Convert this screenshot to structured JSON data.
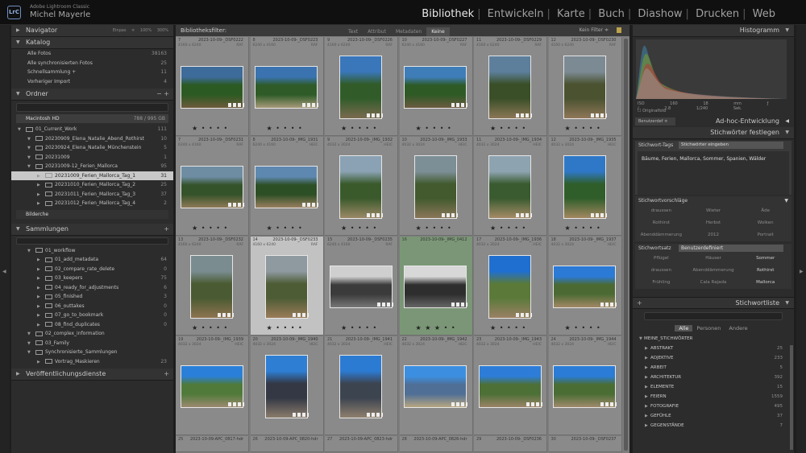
{
  "app": {
    "logo": "LrC",
    "subtitle": "Adobe Lightroom Classic",
    "user": "Michel Mayerle"
  },
  "modules": [
    "Bibliothek",
    "Entwickeln",
    "Karte",
    "Buch",
    "Diashow",
    "Drucken",
    "Web"
  ],
  "active_module": "Bibliothek",
  "left": {
    "navigator": {
      "title": "Navigator",
      "zoom_options": [
        "Einpas ≑",
        "100%",
        "300%"
      ]
    },
    "catalog": {
      "title": "Katalog",
      "items": [
        {
          "label": "Alle Fotos",
          "count": "38163"
        },
        {
          "label": "Alle synchronisierten Fotos",
          "count": "25"
        },
        {
          "label": "Schnellsammlung +",
          "count": "11"
        },
        {
          "label": "Vorheriger Import",
          "count": "4"
        }
      ]
    },
    "folders": {
      "title": "Ordner",
      "volume": "Macintosh HD",
      "volume_info": "788 / 995 GB",
      "items": [
        {
          "label": "01_Current_Work",
          "count": "111",
          "indent": 0
        },
        {
          "label": "20230909_Elena_Natalie_Abend_Rothirst",
          "count": "10",
          "indent": 1
        },
        {
          "label": "20230924_Elena_Natalie_Münchenstein",
          "count": "5",
          "indent": 1
        },
        {
          "label": "20231009",
          "count": "1",
          "indent": 1
        },
        {
          "label": "20231009-12_Ferien_Mallorca",
          "count": "95",
          "indent": 1
        },
        {
          "label": "20231009_Ferien_Mallorca_Tag_1",
          "count": "31",
          "indent": 2,
          "selected": true
        },
        {
          "label": "20231010_Ferien_Mallorca_Tag_2",
          "count": "25",
          "indent": 2
        },
        {
          "label": "20231011_Ferien_Mallorca_Tag_3",
          "count": "37",
          "indent": 2
        },
        {
          "label": "20231012_Ferien_Mallorca_Tag_4",
          "count": "2",
          "indent": 2
        }
      ],
      "footer": "Bilderche"
    },
    "collections": {
      "title": "Sammlungen",
      "items": [
        {
          "label": "01_workflow",
          "count": "",
          "indent": 1
        },
        {
          "label": "01_add_metadata",
          "count": "64",
          "indent": 2
        },
        {
          "label": "02_compare_rate_delete",
          "count": "0",
          "indent": 2
        },
        {
          "label": "03_keepers",
          "count": "75",
          "indent": 2
        },
        {
          "label": "04_ready_for_adjustments",
          "count": "6",
          "indent": 2
        },
        {
          "label": "05_finished",
          "count": "3",
          "indent": 2
        },
        {
          "label": "06_outtakes",
          "count": "0",
          "indent": 2
        },
        {
          "label": "07_go_to_bookmark",
          "count": "0",
          "indent": 2
        },
        {
          "label": "08_find_duplicates",
          "count": "0",
          "indent": 2
        },
        {
          "label": "02_complex_information",
          "count": "",
          "indent": 1
        },
        {
          "label": "03_Family",
          "count": "",
          "indent": 1
        },
        {
          "label": "Synchronisierte_Sammlungen",
          "count": "",
          "indent": 1
        },
        {
          "label": "Vortrag_Maskieren",
          "count": "23",
          "indent": 2
        }
      ]
    },
    "publish": {
      "title": "Veröffentlichungsdienste"
    }
  },
  "filterbar": {
    "label": "Bibliotheksfilter:",
    "tabs": [
      "Text",
      "Attribut",
      "Metadaten",
      "Keine"
    ],
    "active": "Keine",
    "preset": "Kein Filter ≑"
  },
  "grid": {
    "cells": [
      {
        "num": "7",
        "name": "2023-10-09-_DSF0222",
        "dim": "4160 x 6240",
        "ext": "RAF",
        "orient": "land",
        "c": [
          "#3d6b9a",
          "#2b5a22",
          "#6d5a3b"
        ],
        "stars": "★ • • • •"
      },
      {
        "num": "8",
        "name": "2023-10-09-_DSF0223",
        "dim": "6240 x 4160",
        "ext": "RAF",
        "orient": "land",
        "c": [
          "#3a73b0",
          "#2e5b27",
          "#a89a7a"
        ],
        "stars": "★ • • • •"
      },
      {
        "num": "9",
        "name": "2023-10-09-_DSF0226",
        "dim": "4160 x 6240",
        "ext": "RAF",
        "orient": "port",
        "c": [
          "#3a77ba",
          "#315c2a",
          "#7a6a4f"
        ],
        "stars": "★ • • • •"
      },
      {
        "num": "10",
        "name": "2023-10-09-_DSF0227",
        "dim": "6240 x 4160",
        "ext": "RAF",
        "orient": "land",
        "c": [
          "#3f7db9",
          "#2e5a26",
          "#6b5a40"
        ],
        "stars": "★ • • • •"
      },
      {
        "num": "11",
        "name": "2023-10-09-_DSF0229",
        "dim": "4160 x 6240",
        "ext": "RAF",
        "orient": "port",
        "c": [
          "#5d7f9c",
          "#3a4f28",
          "#8c7656"
        ],
        "stars": "★ • • • •"
      },
      {
        "num": "12",
        "name": "2023-10-09-_DSF0230",
        "dim": "4160 x 6240",
        "ext": "RAF",
        "orient": "port",
        "c": [
          "#7c8a94",
          "#4a5230",
          "#8f7758"
        ],
        "stars": "★ • • • •"
      },
      {
        "num": "7",
        "name": "2023-10-09-_DSF0231",
        "dim": "6240 x 4160",
        "ext": "RAF",
        "orient": "land",
        "c": [
          "#6e8da3",
          "#34532a",
          "#8f7a58"
        ],
        "stars": "★ • • • •"
      },
      {
        "num": "8",
        "name": "2023-10-09-_IMG_1931",
        "dim": "6240 x 4160",
        "ext": "HEIC",
        "orient": "land",
        "c": [
          "#5f88b0",
          "#2d4f25",
          "#9a7f60"
        ],
        "stars": "★ • • • •"
      },
      {
        "num": "9",
        "name": "2023-10-09-_IMG_1932",
        "dim": "4032 x 3024",
        "ext": "HEIC",
        "orient": "port",
        "c": [
          "#8aa2b3",
          "#3a5a2c",
          "#9b8866"
        ],
        "stars": "★ • • • •"
      },
      {
        "num": "10",
        "name": "2023-10-09-_IMG_1933",
        "dim": "4032 x 3024",
        "ext": "HEIC",
        "orient": "port",
        "c": [
          "#7c8f96",
          "#425a2e",
          "#8a7658"
        ],
        "stars": "★ • • • •"
      },
      {
        "num": "11",
        "name": "2023-10-09-_IMG_1934",
        "dim": "4032 x 3024",
        "ext": "HEIC",
        "orient": "port",
        "c": [
          "#8ea3b0",
          "#3a5b30",
          "#a48b66"
        ],
        "stars": "★ • • • •"
      },
      {
        "num": "12",
        "name": "2023-10-09-_IMG_1935",
        "dim": "4032 x 3024",
        "ext": "HEIC",
        "orient": "port",
        "c": [
          "#2f78c7",
          "#2f5e2a",
          "#a38760"
        ],
        "stars": "★ • • • •"
      },
      {
        "num": "13",
        "name": "2023-10-09-_DSF0232",
        "dim": "4160 x 6240",
        "ext": "RAF",
        "orient": "port",
        "c": [
          "#7a8c90",
          "#4a5b33",
          "#8e7350"
        ],
        "stars": "★ • • • •"
      },
      {
        "num": "14",
        "name": "2023-10-09-_DSF0233",
        "dim": "4160 x 6240",
        "ext": "RAF",
        "orient": "port",
        "c": [
          "#8f9aa0",
          "#4d5c35",
          "#9a7c58"
        ],
        "stars": "★ • • • •",
        "sel": true
      },
      {
        "num": "15",
        "name": "2023-10-09-_DSF0235",
        "dim": "6240 x 4160",
        "ext": "RAF",
        "orient": "land",
        "c": [
          "#cfcfcf",
          "#3b3b3b",
          "#777777"
        ],
        "stars": "★ • • • •"
      },
      {
        "num": "16",
        "name": "2023-10-09-_IMG_0412",
        "dim": "",
        "ext": "",
        "orient": "land",
        "c": [
          "#d8d8d8",
          "#2e2e2e",
          "#666666"
        ],
        "stars": "★ ★ ★ • •",
        "green": true
      },
      {
        "num": "17",
        "name": "2023-10-09-_IMG_1936",
        "dim": "4032 x 3024",
        "ext": "HEIC",
        "orient": "port",
        "c": [
          "#1f6fd0",
          "#5b7a3a",
          "#9a8064"
        ],
        "stars": "★ • • • •"
      },
      {
        "num": "18",
        "name": "2023-10-09-_IMG_1937",
        "dim": "4032 x 3024",
        "ext": "HEIC",
        "orient": "land",
        "c": [
          "#2b7ad6",
          "#4b6a33",
          "#a38866"
        ],
        "stars": "★ • • • •"
      },
      {
        "num": "19",
        "name": "2023-10-09-_IMG_1939",
        "dim": "4032 x 3024",
        "ext": "HEIC",
        "orient": "land",
        "c": [
          "#2a80d8",
          "#4f7a3a",
          "#9c8a70"
        ],
        "stars": ""
      },
      {
        "num": "20",
        "name": "2023-10-09-_IMG_1940",
        "dim": "4032 x 3024",
        "ext": "HEIC",
        "orient": "port",
        "c": [
          "#2e7fd4",
          "#333844",
          "#8a7c6c"
        ],
        "stars": ""
      },
      {
        "num": "21",
        "name": "2023-10-09-_IMG_1941",
        "dim": "4032 x 3024",
        "ext": "HEIC",
        "orient": "port",
        "c": [
          "#2c7bd3",
          "#3c4450",
          "#8e7f6e"
        ],
        "stars": ""
      },
      {
        "num": "22",
        "name": "2023-10-09-_IMG_1942",
        "dim": "4032 x 3024",
        "ext": "HEIC",
        "orient": "land",
        "c": [
          "#3c8fe0",
          "#4f6f96",
          "#b8a680"
        ],
        "stars": ""
      },
      {
        "num": "23",
        "name": "2023-10-09-_IMG_1943",
        "dim": "4032 x 3024",
        "ext": "HEIC",
        "orient": "land",
        "c": [
          "#2d7dd8",
          "#4d7036",
          "#9b8468"
        ],
        "stars": ""
      },
      {
        "num": "24",
        "name": "2023-10-09-_IMG_1944",
        "dim": "4032 x 3024",
        "ext": "HEIC",
        "orient": "land",
        "c": [
          "#2a7cd6",
          "#4a6d34",
          "#a08a6c"
        ],
        "stars": ""
      },
      {
        "num": "25",
        "name": "2023-10-09-APC_0817-hdr",
        "dim": "",
        "ext": "",
        "orient": "land",
        "c": [
          "#777",
          "#777",
          "#777"
        ],
        "stars": ""
      },
      {
        "num": "26",
        "name": "2023-10-09-APC_0820-hdr",
        "dim": "",
        "ext": "",
        "orient": "land",
        "c": [
          "#777",
          "#777",
          "#777"
        ],
        "stars": ""
      },
      {
        "num": "27",
        "name": "2023-10-09-APC_0823-hdr",
        "dim": "",
        "ext": "",
        "orient": "land",
        "c": [
          "#777",
          "#777",
          "#777"
        ],
        "stars": ""
      },
      {
        "num": "28",
        "name": "2023-10-09-APC_0826-hdr",
        "dim": "",
        "ext": "",
        "orient": "land",
        "c": [
          "#777",
          "#777",
          "#777"
        ],
        "stars": ""
      },
      {
        "num": "29",
        "name": "2023-10-09-_DSF0236",
        "dim": "",
        "ext": "",
        "orient": "land",
        "c": [
          "#777",
          "#777",
          "#777"
        ],
        "stars": ""
      },
      {
        "num": "30",
        "name": "2023-10-09-_DSF0237",
        "dim": "",
        "ext": "",
        "orient": "land",
        "c": [
          "#777",
          "#777",
          "#777"
        ],
        "stars": ""
      }
    ]
  },
  "right": {
    "histogram": {
      "title": "Histogramm",
      "iso": "ISO 160",
      "focal": "18 mm",
      "aperture": "ƒ / 2.8",
      "shutter": "1/240 Sek.",
      "checkbox": "Originalfoto"
    },
    "quick": {
      "dropdown": "Benutzerdef ≑",
      "title": "Ad-hoc-Entwicklung"
    },
    "keywording": {
      "title": "Stichwörter festlegen",
      "tags_label": "Stichwort-Tags",
      "tags_input": "Stichwörter eingeben",
      "keywords": "Bäume, Ferien, Mallorca, Sommer, Spanien, Wälder",
      "suggest_title": "Stichwortvorschläge",
      "suggestions": [
        [
          "draussen",
          "Wieter",
          "Äde"
        ],
        [
          "Rothirst",
          "Herbst",
          "Wolken"
        ],
        [
          "Abenddämmerung",
          "2012",
          "Portrait"
        ]
      ],
      "set_label": "Stichwortsatz",
      "set_value": "Benutzerdefiniert",
      "set": [
        [
          "Pflügel",
          "Häuser",
          "Sommer"
        ],
        [
          "draussen",
          "Abenddämmerung",
          "Rothirst"
        ],
        [
          "Frühling",
          "Cala Rajada",
          "Mallorca"
        ]
      ]
    },
    "kwlist": {
      "title": "Stichwortliste",
      "tabs": [
        "Alle",
        "Personen",
        "Andere"
      ],
      "active_tab": "Alle",
      "root": "MEINE_STICHWÖRTER",
      "items": [
        {
          "label": "ABSTRAKT",
          "count": "25"
        },
        {
          "label": "ADJEKTIVE",
          "count": "233"
        },
        {
          "label": "ARBEIT",
          "count": "5"
        },
        {
          "label": "ARCHITEKTUR",
          "count": "392"
        },
        {
          "label": "ELEMENTE",
          "count": "15"
        },
        {
          "label": "FEIERN",
          "count": "1559"
        },
        {
          "label": "FOTOGRAFIE",
          "count": "495"
        },
        {
          "label": "GEFÜHLE",
          "count": "37"
        },
        {
          "label": "GEGENSTÄNDE",
          "count": "7"
        }
      ]
    }
  }
}
